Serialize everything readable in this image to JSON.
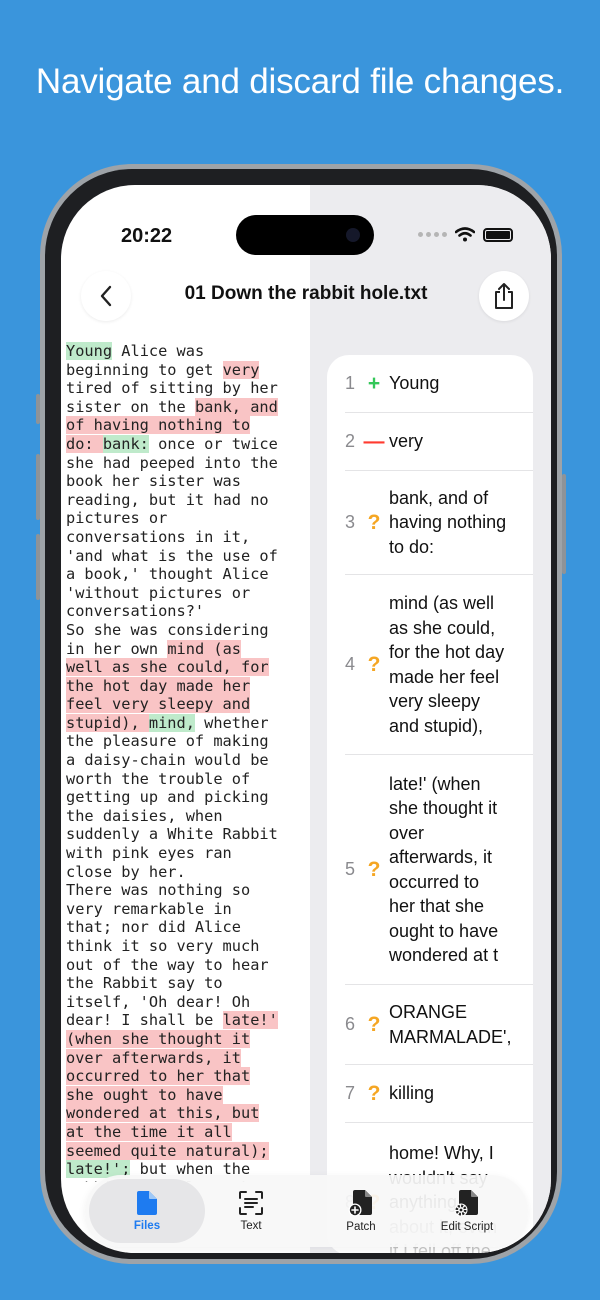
{
  "headline": "Navigate and discard file changes.",
  "status": {
    "time": "20:22"
  },
  "nav": {
    "title": "01 Down the rabbit hole.txt",
    "back_icon": "chevron-left-icon",
    "share_icon": "share-icon"
  },
  "text_lines": [
    [
      {
        "t": "Young",
        "k": "add"
      },
      {
        "t": " Alice was"
      }
    ],
    [
      {
        "t": "beginning to get "
      },
      {
        "t": "very",
        "k": "del"
      }
    ],
    [
      {
        "t": "tired of sitting by her"
      }
    ],
    [
      {
        "t": "sister on the "
      },
      {
        "t": "bank, and",
        "k": "del"
      }
    ],
    [
      {
        "t": "of having nothing to",
        "k": "del"
      }
    ],
    [
      {
        "t": "do: ",
        "k": "del"
      },
      {
        "t": "bank:",
        "k": "add"
      },
      {
        "t": " once or twice"
      }
    ],
    [
      {
        "t": "she had peeped into the"
      }
    ],
    [
      {
        "t": "book her sister was"
      }
    ],
    [
      {
        "t": "reading, but it had no"
      }
    ],
    [
      {
        "t": "pictures or"
      }
    ],
    [
      {
        "t": "conversations in it,"
      }
    ],
    [
      {
        "t": "'and what is the use of"
      }
    ],
    [
      {
        "t": "a book,' thought Alice"
      }
    ],
    [
      {
        "t": "'without pictures or"
      }
    ],
    [
      {
        "t": "conversations?'"
      }
    ],
    [
      {
        "t": "So she was considering"
      }
    ],
    [
      {
        "t": "in her own "
      },
      {
        "t": "mind (as",
        "k": "del"
      }
    ],
    [
      {
        "t": "well as she could, for",
        "k": "del"
      }
    ],
    [
      {
        "t": "the hot day made her",
        "k": "del"
      }
    ],
    [
      {
        "t": "feel very sleepy and",
        "k": "del"
      }
    ],
    [
      {
        "t": "stupid), ",
        "k": "del"
      },
      {
        "t": "mind,",
        "k": "add"
      },
      {
        "t": " whether"
      }
    ],
    [
      {
        "t": "the pleasure of making"
      }
    ],
    [
      {
        "t": "a daisy-chain would be"
      }
    ],
    [
      {
        "t": "worth the trouble of"
      }
    ],
    [
      {
        "t": "getting up and picking"
      }
    ],
    [
      {
        "t": "the daisies, when"
      }
    ],
    [
      {
        "t": "suddenly a White Rabbit"
      }
    ],
    [
      {
        "t": "with pink eyes ran"
      }
    ],
    [
      {
        "t": "close by her."
      }
    ],
    [
      {
        "t": "There was nothing so"
      }
    ],
    [
      {
        "t": "very remarkable in"
      }
    ],
    [
      {
        "t": "that; nor did Alice"
      }
    ],
    [
      {
        "t": "think it so very much"
      }
    ],
    [
      {
        "t": "out of the way to hear"
      }
    ],
    [
      {
        "t": "the Rabbit say to"
      }
    ],
    [
      {
        "t": "itself, 'Oh dear! Oh"
      }
    ],
    [
      {
        "t": "dear! I shall be "
      },
      {
        "t": "late!'",
        "k": "del"
      }
    ],
    [
      {
        "t": "(when she thought it",
        "k": "del"
      }
    ],
    [
      {
        "t": "over afterwards, it",
        "k": "del"
      }
    ],
    [
      {
        "t": "occurred to her that",
        "k": "del"
      }
    ],
    [
      {
        "t": "she ought to have",
        "k": "del"
      }
    ],
    [
      {
        "t": "wondered at this, but",
        "k": "del"
      }
    ],
    [
      {
        "t": "at the time it all",
        "k": "del"
      }
    ],
    [
      {
        "t": "seemed quite natural);",
        "k": "del"
      }
    ],
    [
      {
        "t": "late!';",
        "k": "add"
      },
      {
        "t": " but when the"
      }
    ],
    [
      {
        "t": "Rabbit actually took a"
      }
    ]
  ],
  "changes": [
    {
      "num": "1",
      "symbol": "+",
      "kind": "add",
      "text": "Young",
      "height": 58
    },
    {
      "num": "2",
      "symbol": "—",
      "kind": "del",
      "text": "very",
      "height": 58
    },
    {
      "num": "3",
      "symbol": "?",
      "kind": "q",
      "text": "bank, and of\nhaving nothing\nto do:",
      "height": 104
    },
    {
      "num": "4",
      "symbol": "?",
      "kind": "q",
      "text": "mind (as well\nas she could,\nfor the hot day\nmade her feel\nvery sleepy\nand stupid),",
      "height": 180
    },
    {
      "num": "5",
      "symbol": "?",
      "kind": "q",
      "text": "late!' (when\nshe thought it\nover\nafterwards, it\noccurred to\nher that she\nought to have\nwondered at t",
      "height": 230
    },
    {
      "num": "6",
      "symbol": "?",
      "kind": "q",
      "text": "ORANGE\nMARMALADE',",
      "height": 80
    },
    {
      "num": "7",
      "symbol": "?",
      "kind": "q",
      "text": "killing",
      "height": 58
    },
    {
      "num": "8",
      "symbol": "?",
      "kind": "q",
      "text": "home! Why, I\nwouldn't say\nanything\nabout it, even\nif I fell off the",
      "height": 160
    }
  ],
  "tabs": [
    {
      "label": "Files",
      "icon": "file-icon",
      "active": true
    },
    {
      "label": "Text",
      "icon": "text-scan-icon",
      "active": false
    },
    {
      "label": "Patch",
      "icon": "patch-icon",
      "active": false
    },
    {
      "label": "Edit Script",
      "icon": "edit-script-icon",
      "active": false
    }
  ],
  "colors": {
    "background": "#3a95dc",
    "added": "#bfeacb",
    "removed": "#f9c4c5",
    "accent": "#1e7bf0",
    "conflict": "#f5a623"
  }
}
